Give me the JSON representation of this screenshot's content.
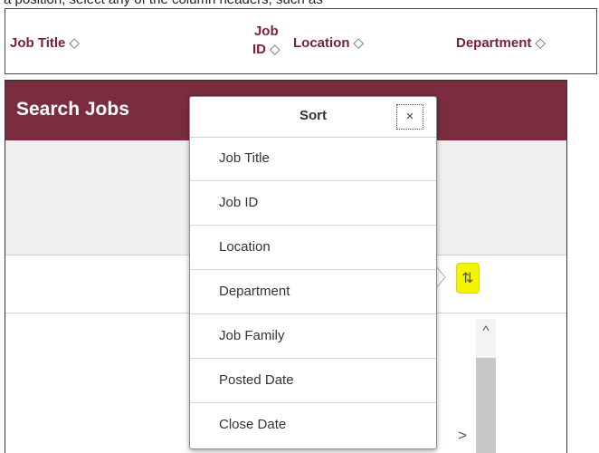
{
  "top_strip": {
    "cut_text": "a position, select any of the column headers, such as",
    "columns": {
      "job_title": "Job Title",
      "job_id_line1": "Job",
      "job_id_line2": "ID",
      "location": "Location",
      "department": "Department"
    }
  },
  "panel": {
    "title": "Search Jobs"
  },
  "sort_popup": {
    "title": "Sort",
    "close_label": "×",
    "options": [
      "Job Title",
      "Job ID",
      "Location",
      "Department",
      "Job Family",
      "Posted Date",
      "Close Date"
    ]
  },
  "icons": {
    "sort_indicator": "◇",
    "sort_button": "⇅",
    "scroll_up": "^",
    "scroll_right": ">"
  },
  "colors": {
    "brand_maroon": "#7a2d3f",
    "highlight_yellow": "#f4f400",
    "header_text": "#7a2135"
  }
}
